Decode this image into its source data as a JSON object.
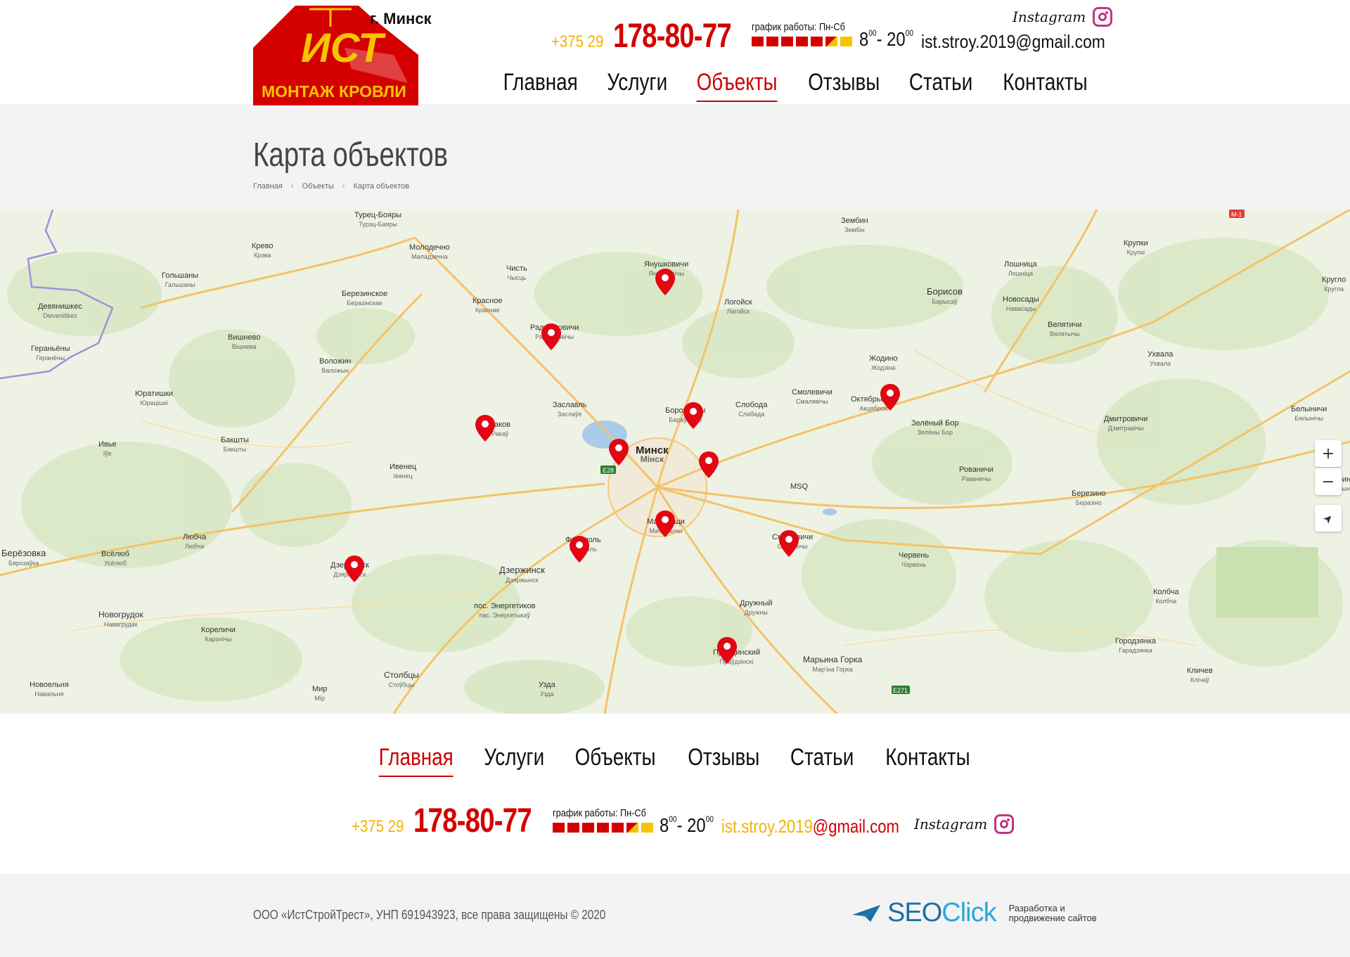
{
  "header": {
    "logo_text_top": "ИСТ",
    "logo_text_bottom": "МОНТАЖ КРОВЛИ",
    "city": "г. Минск",
    "phone_prefix": "+375 29",
    "phone_main": "178-80-77",
    "schedule_label": "график работы: Пн-Сб",
    "hours_from": "8",
    "hours_from_min": "00",
    "hours_sep": "- ",
    "hours_to": "20",
    "hours_to_min": "00",
    "email": "ist.stroy.2019@gmail.com",
    "instagram_label": "Instagram",
    "nav": [
      {
        "label": "Главная"
      },
      {
        "label": "Услуги"
      },
      {
        "label": "Объекты",
        "active": true
      },
      {
        "label": "Отзывы"
      },
      {
        "label": "Статьи"
      },
      {
        "label": "Контакты"
      }
    ]
  },
  "page": {
    "title": "Карта объектов",
    "breadcrumbs": [
      "Главная",
      "Объекты",
      "Карта объектов"
    ]
  },
  "map": {
    "controls": {
      "zoom_in": "+",
      "zoom_out": "−",
      "locate": "➤"
    },
    "places": [
      {
        "name": "Турец-Бояры",
        "sub": "Турэц-Баяры"
      },
      {
        "name": "Молодечно",
        "sub": "Маладзечна"
      },
      {
        "name": "Зембин",
        "sub": "Зембін"
      },
      {
        "name": "Крупки",
        "sub": "Крупкі"
      },
      {
        "name": "Янушковичи",
        "sub": "Янушковічы"
      },
      {
        "name": "Лошница",
        "sub": "Лошніца"
      },
      {
        "name": "Крево",
        "sub": "Крэва"
      },
      {
        "name": "Чисть",
        "sub": "Чысць"
      },
      {
        "name": "Гольшаны",
        "sub": "Гальшаны"
      },
      {
        "name": "Березинское",
        "sub": "Беразінскае"
      },
      {
        "name": "Борисов",
        "sub": "Барысаў"
      },
      {
        "name": "Новосады",
        "sub": "Навасады"
      },
      {
        "name": "Девянишкес",
        "sub": "Dieveniškės"
      },
      {
        "name": "Красное",
        "sub": "Краснае"
      },
      {
        "name": "Логойск",
        "sub": "Лагойск"
      },
      {
        "name": "Радошковичи",
        "sub": "Радашковічы"
      },
      {
        "name": "Велятичи",
        "sub": "Вялятычы"
      },
      {
        "name": "Гераньёны",
        "sub": "Геранёны"
      },
      {
        "name": "Вишнево",
        "sub": "Вішнева"
      },
      {
        "name": "Воложин",
        "sub": "Валожын"
      },
      {
        "name": "Жодино",
        "sub": "Жодзіна"
      },
      {
        "name": "Ухвала",
        "sub": "Ухвала"
      },
      {
        "name": "Юратишки",
        "sub": "Юрацішкі"
      },
      {
        "name": "Смолевичи",
        "sub": "Смалявічы"
      },
      {
        "name": "Октябрьский",
        "sub": "Акцябрскі"
      },
      {
        "name": "Заславль",
        "sub": "Заслаўе"
      },
      {
        "name": "Боровляны",
        "sub": "Бараўляны"
      },
      {
        "name": "Слобода",
        "sub": "Слабада"
      },
      {
        "name": "Зелёный Бор",
        "sub": "Зялёны Бор"
      },
      {
        "name": "Дмитровичи",
        "sub": "Дзмітравічы"
      },
      {
        "name": "Белыничи",
        "sub": "Бялынічы"
      },
      {
        "name": "Раков",
        "sub": "Ракаў"
      },
      {
        "name": "Ивье",
        "sub": "Іўе"
      },
      {
        "name": "Бакшты",
        "sub": "Бакшты"
      },
      {
        "name": "Ивенец",
        "sub": "Івянец"
      },
      {
        "name": "Минск",
        "sub": "Мінск",
        "big": true
      },
      {
        "name": "Рованичи",
        "sub": "Раваничы"
      },
      {
        "name": "MSQ",
        "sub": ""
      },
      {
        "name": "Березино",
        "sub": "Беразіно"
      },
      {
        "name": "Любча",
        "sub": "Любча"
      },
      {
        "name": "Берёзовка",
        "sub": "Бярозаўка"
      },
      {
        "name": "Всёлюб",
        "sub": "Усёлюб"
      },
      {
        "name": "Мачулищи",
        "sub": "Мачулішчы"
      },
      {
        "name": "Фаниполь",
        "sub": "Фаніпаль"
      },
      {
        "name": "Смиловичи",
        "sub": "Смілавічы"
      },
      {
        "name": "Червень",
        "sub": "Чэрвень"
      },
      {
        "name": "Дзержинск",
        "sub": "Дзяржынск"
      },
      {
        "name": "Дзержинск",
        "sub": "Дзяржынск"
      },
      {
        "name": "Колбча",
        "sub": "Колбча"
      },
      {
        "name": "Новогрудок",
        "sub": "Навагрудак"
      },
      {
        "name": "пос. Энергетиков",
        "sub": "пас. Энергетыкаў"
      },
      {
        "name": "Дружный",
        "sub": "Дружны"
      },
      {
        "name": "Кореличи",
        "sub": "Карэлічы"
      },
      {
        "name": "Городзянка",
        "sub": "Гарадзянка"
      },
      {
        "name": "Правдинский",
        "sub": "Праўдзінскі"
      },
      {
        "name": "Марьина Горка",
        "sub": "Мар'іна Горка"
      },
      {
        "name": "Кличев",
        "sub": "Клічаў"
      },
      {
        "name": "Столбцы",
        "sub": "Стоўбцы"
      },
      {
        "name": "Новоельня",
        "sub": "Навальня"
      },
      {
        "name": "Мир",
        "sub": "Мір"
      },
      {
        "name": "Узда",
        "sub": "Узда"
      },
      {
        "name": "Кругло",
        "sub": "Кругла"
      },
      {
        "name": "Тетерин",
        "sub": "Цяцерын"
      }
    ],
    "road_labels": [
      "E28",
      "M-1",
      "E271"
    ]
  },
  "footer": {
    "nav": [
      {
        "label": "Главная",
        "active": true
      },
      {
        "label": "Услуги"
      },
      {
        "label": "Объекты"
      },
      {
        "label": "Отзывы"
      },
      {
        "label": "Статьи"
      },
      {
        "label": "Контакты"
      }
    ],
    "phone_prefix": "+375 29",
    "phone_main": "178-80-77",
    "schedule_label": "график работы: Пн-Сб",
    "hours_from": "8",
    "hours_from_min": "00",
    "hours_sep": "- ",
    "hours_to": "20",
    "hours_to_min": "00",
    "email_user": "ist.stroy.2019",
    "email_domain": "@gmail.com",
    "instagram_label": "Instagram",
    "copyright": "ООО «ИстСтройТрест», УНП 691943923, все права защищены © 2020",
    "dev_logo_a": "SEO",
    "dev_logo_b": "Click",
    "dev_text_1": "Разработка и",
    "dev_text_2": "продвижение сайтов"
  },
  "colors": {
    "brand_red": "#d40000",
    "brand_yellow": "#f6c500",
    "nav_active": "#c00"
  }
}
